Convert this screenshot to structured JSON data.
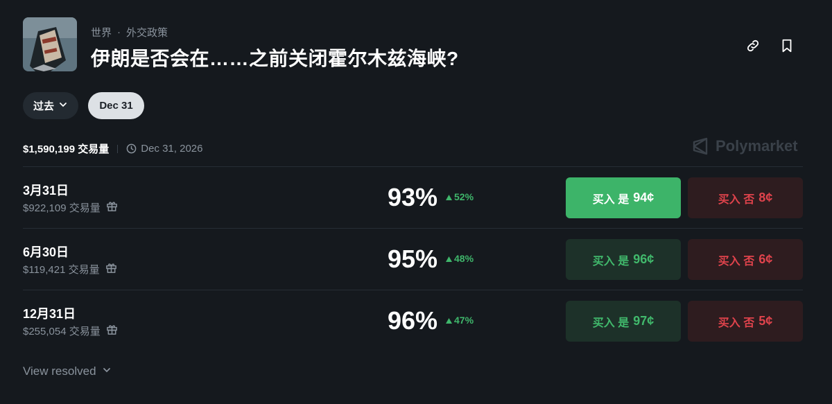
{
  "header": {
    "category": "世界",
    "separator": "·",
    "subcategory": "外交政策",
    "title": "伊朗是否会在……之前关闭霍尔木兹海峡?"
  },
  "filters": {
    "past_label": "过去",
    "date_label": "Dec 31"
  },
  "meta": {
    "volume": "$1,590,199 交易量",
    "end_date": "Dec 31, 2026"
  },
  "brand": "Polymarket",
  "markets": [
    {
      "date": "3月31日",
      "volume": "$922,109 交易量",
      "percent": "93%",
      "change": "52%",
      "yes_label": "买入 是",
      "yes_price": "94¢",
      "no_label": "买入 否",
      "no_price": "8¢"
    },
    {
      "date": "6月30日",
      "volume": "$119,421 交易量",
      "percent": "95%",
      "change": "48%",
      "yes_label": "买入 是",
      "yes_price": "96¢",
      "no_label": "买入 否",
      "no_price": "6¢"
    },
    {
      "date": "12月31日",
      "volume": "$255,054 交易量",
      "percent": "96%",
      "change": "47%",
      "yes_label": "买入 是",
      "yes_price": "97¢",
      "no_label": "买入 否",
      "no_price": "5¢"
    }
  ],
  "footer": {
    "view_resolved": "View resolved"
  },
  "colors": {
    "background": "#15191e",
    "yes_green": "#3db469",
    "no_red": "#e0434c",
    "muted": "#8a939d"
  }
}
